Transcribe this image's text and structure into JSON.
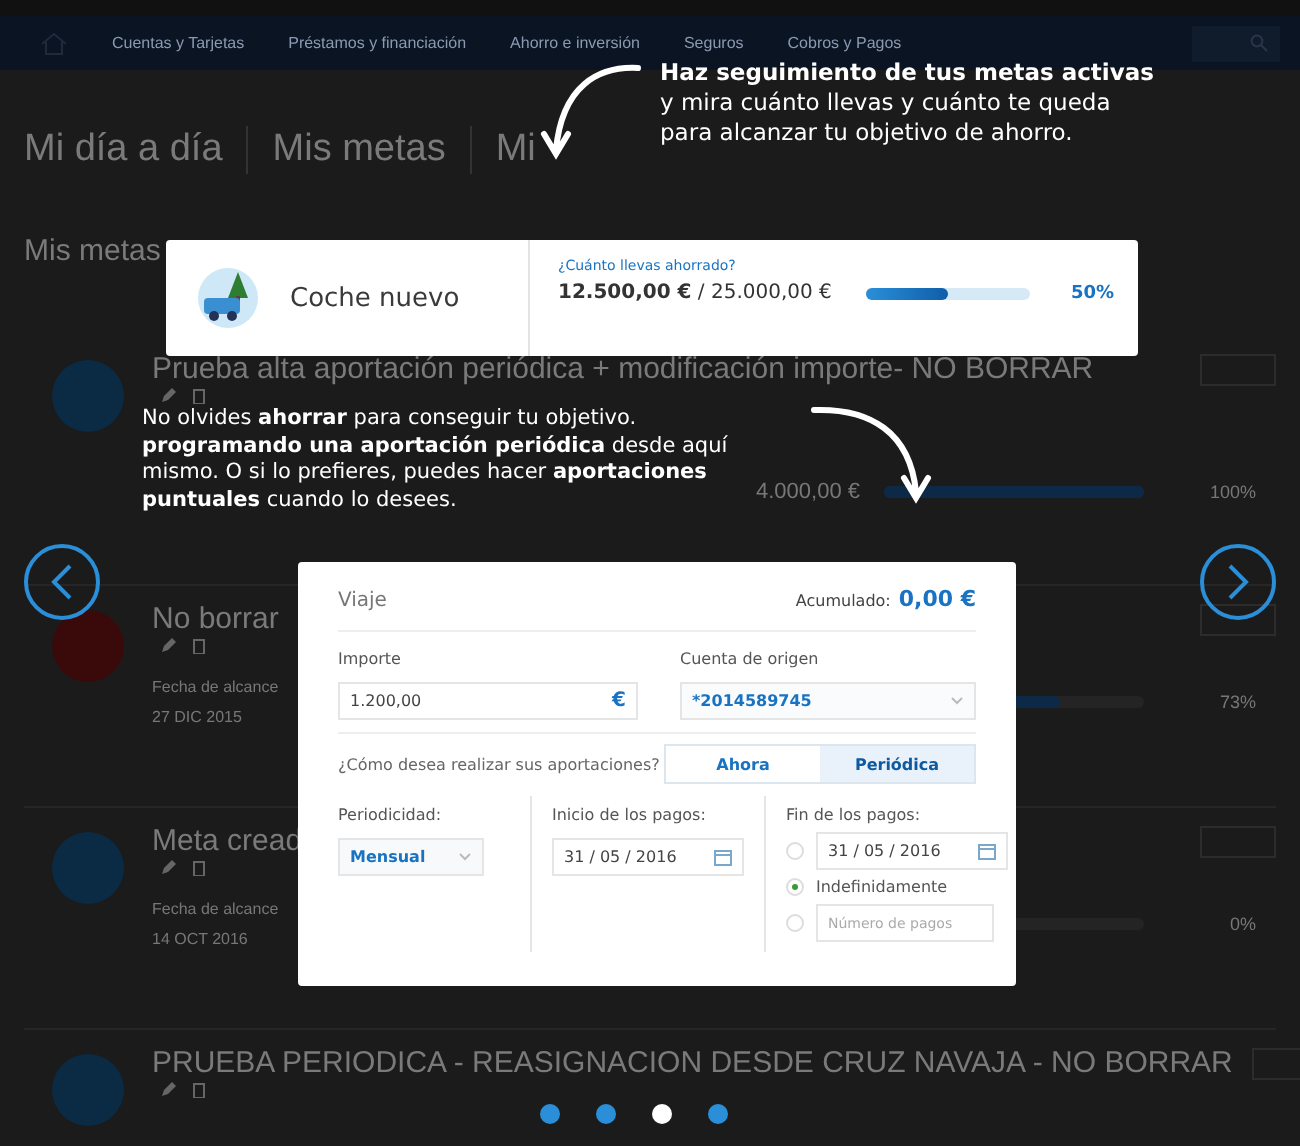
{
  "background_page": {
    "nav": [
      "Cuentas y Tarjetas",
      "Préstamos y financiación",
      "Ahorro e inversión",
      "Seguros",
      "Cobros y Pagos"
    ],
    "breadcrumb": [
      "Mi día a día",
      "Mis metas",
      "Mi"
    ],
    "section_title": "Mis metas",
    "goals": [
      {
        "title": "Prueba alta aportación periódica + modificación importe- NO BORRAR",
        "color": "#0b2a44",
        "amount": "4.000,00 €",
        "level": 1,
        "percent": "100%"
      },
      {
        "title": "No borrar",
        "color": "#3a0a0a",
        "date_label": "Fecha de alcance",
        "date": "27 DIC 2015",
        "level": 0.73,
        "percent": "73%"
      },
      {
        "title": "Meta cread",
        "color": "#0b2a44",
        "date_label": "Fecha de alcance",
        "date": "14 OCT 2016",
        "level": 0,
        "percent": "0%"
      },
      {
        "title": "PRUEBA PERIODICA - REASIGNACION DESDE CRUZ NAVAJA - NO BORRAR",
        "color": "#0b2a44"
      }
    ]
  },
  "tips": [
    "**Haz seguimiento de tus metas activas** y mira cuánto llevas y cuánto te queda para alcanzar tu objetivo de ahorro.",
    "No olvides **ahorrar** para conseguir tu objetivo. **programando una aportación periódica** desde aquí mismo. O si lo prefieres, puedes hacer **aportaciones puntuales** cuando lo desees."
  ],
  "goal_card": {
    "title": "Coche nuevo",
    "question": "¿Cuánto llevas ahorrado?",
    "saved": "12.500,00 €",
    "total": "/ 25.000,00 €",
    "level": 0.5,
    "percent": "50%"
  },
  "contribution_form": {
    "title": "Viaje",
    "accumulated_label": "Acumulado:",
    "accumulated": "0,00 €",
    "amount_label": "Importe",
    "amount": "1.200,00",
    "currency": "€",
    "account_label": "Cuenta de origen",
    "account": "*2014589745",
    "question": "¿Cómo desea realizar sus aportaciones?",
    "modes": [
      {
        "label": "Ahora",
        "selected": false
      },
      {
        "label": "Periódica",
        "selected": true
      }
    ],
    "periodicity_label": "Periodicidad:",
    "periodicity": "Mensual",
    "start_label": "Inicio de los pagos:",
    "start_date": "31 / 05 / 2016",
    "end_label": "Fin de los pagos:",
    "end_options": [
      {
        "kind": "date",
        "value": "31 / 05 / 2016",
        "selected": false
      },
      {
        "kind": "text",
        "label": "Indefinidamente",
        "selected": true
      },
      {
        "kind": "input",
        "placeholder": "Número de pagos",
        "selected": false
      }
    ]
  },
  "pager": [
    {
      "selected": false
    },
    {
      "selected": false
    },
    {
      "selected": true
    },
    {
      "selected": false
    }
  ]
}
